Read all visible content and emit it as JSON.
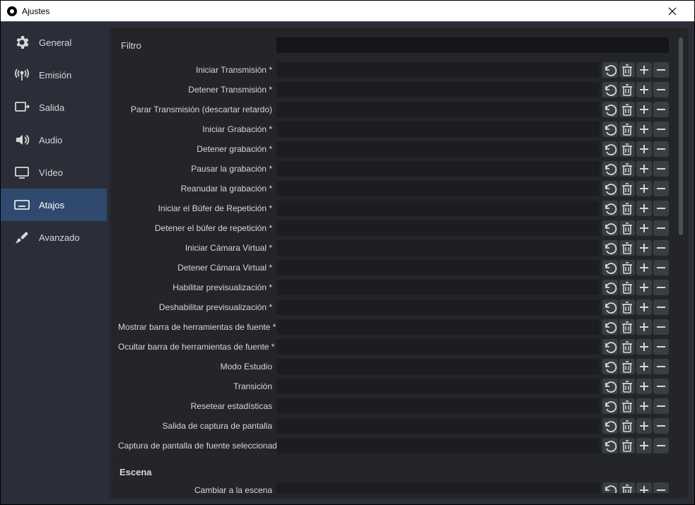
{
  "window": {
    "title": "Ajustes"
  },
  "sidebar": {
    "items": [
      {
        "label": "General"
      },
      {
        "label": "Emisión"
      },
      {
        "label": "Salida"
      },
      {
        "label": "Audio"
      },
      {
        "label": "Vídeo"
      },
      {
        "label": "Atajos"
      },
      {
        "label": "Avanzado"
      }
    ],
    "active_index": 5
  },
  "filter": {
    "label": "Filtro",
    "value": ""
  },
  "hotkeys": [
    {
      "label": "Iniciar Transmisión *"
    },
    {
      "label": "Detener Transmisión *"
    },
    {
      "label": "Parar Transmisión (descartar retardo)"
    },
    {
      "label": "Iniciar Grabación *"
    },
    {
      "label": "Detener grabación *"
    },
    {
      "label": "Pausar la grabación *"
    },
    {
      "label": "Reanudar la grabación *"
    },
    {
      "label": "Iniciar el Búfer de Repetición *"
    },
    {
      "label": "Detener el búfer de repetición *"
    },
    {
      "label": "Iniciar Cámara Virtual *"
    },
    {
      "label": "Detener Cámara Virtual *"
    },
    {
      "label": "Habilitar previsualización *"
    },
    {
      "label": "Deshabilitar previsualización *"
    },
    {
      "label": "Mostrar barra de herramientas de fuente *"
    },
    {
      "label": "Ocultar barra de herramientas de fuente *"
    },
    {
      "label": "Modo Estudio"
    },
    {
      "label": "Transición"
    },
    {
      "label": "Resetear estadísticas"
    },
    {
      "label": "Salida de captura de pantalla"
    },
    {
      "label": "Captura de pantalla de fuente seleccionada"
    }
  ],
  "sections": [
    {
      "header": "Escena",
      "hotkeys": [
        {
          "label": "Cambiar a la escena"
        }
      ]
    }
  ],
  "icons": {
    "undo": "undo-icon",
    "trash": "trash-icon",
    "plus": "plus-icon",
    "minus": "minus-icon"
  }
}
